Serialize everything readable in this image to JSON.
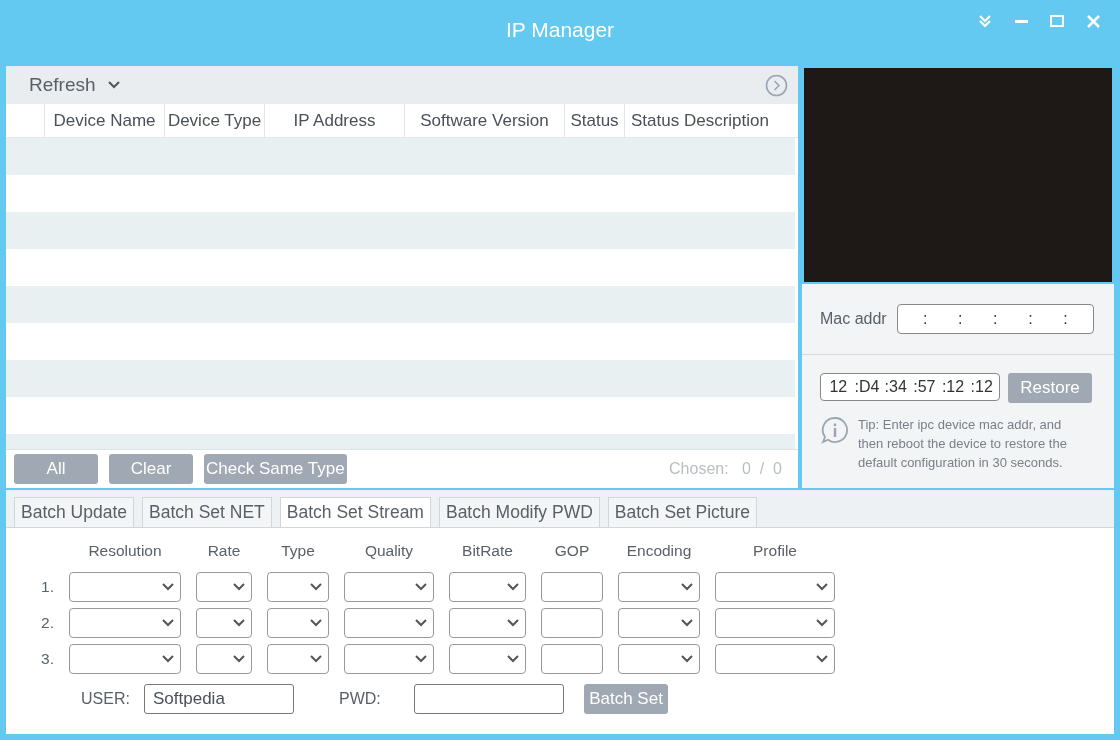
{
  "window": {
    "title": "IP Manager"
  },
  "toolbar": {
    "refresh": "Refresh"
  },
  "table": {
    "columns": [
      "Device Name",
      "Device Type",
      "IP Address",
      "Software Version",
      "Status",
      "Status Description"
    ]
  },
  "selection_buttons": [
    "All",
    "Clear",
    "Check Same Type"
  ],
  "chosen": {
    "label": "Chosen:",
    "count": "0",
    "separator": "/",
    "total": "0"
  },
  "mac": {
    "label": "Mac addr",
    "separators": [
      ":",
      ":",
      ":",
      ":",
      ":"
    ]
  },
  "restore": {
    "segments": [
      "12",
      ":D4",
      ":34",
      ":57",
      ":12",
      ":12"
    ],
    "button": "Restore",
    "tip": "Tip: Enter ipc device mac addr, and then reboot the device to restore the default configuration in 30 seconds."
  },
  "tabs": [
    {
      "label": "Batch Update",
      "selected": false
    },
    {
      "label": "Batch Set NET",
      "selected": false
    },
    {
      "label": "Batch Set Stream",
      "selected": true
    },
    {
      "label": "Batch Modify PWD",
      "selected": false
    },
    {
      "label": "Batch Set Picture",
      "selected": false
    }
  ],
  "stream": {
    "columns": [
      {
        "label": "Resolution",
        "kind": "dropdown"
      },
      {
        "label": "Rate",
        "kind": "dropdown"
      },
      {
        "label": "Type",
        "kind": "dropdown"
      },
      {
        "label": "Quality",
        "kind": "dropdown"
      },
      {
        "label": "BitRate",
        "kind": "dropdown"
      },
      {
        "label": "GOP",
        "kind": "field"
      },
      {
        "label": "Encoding",
        "kind": "dropdown"
      },
      {
        "label": "Profile",
        "kind": "dropdown"
      }
    ],
    "rows": [
      "1.",
      "2.",
      "3."
    ],
    "user_label": "USER:",
    "user_value": "Softpedia",
    "pwd_label": "PWD:",
    "button": "Batch Set"
  }
}
